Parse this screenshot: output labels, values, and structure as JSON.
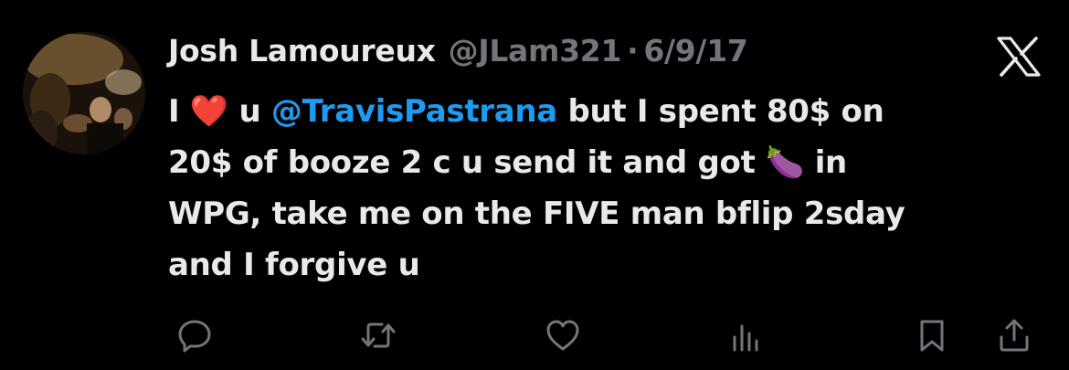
{
  "tweet": {
    "author_name": "Josh Lamoureux",
    "handle": "@JLam321",
    "separator": "·",
    "date": "6/9/17",
    "text_lines": [
      {
        "pre": "I ",
        "emoji": "❤️",
        "mid": " u ",
        "mention": "@TravisPastrana",
        "post": " but I spent 80$ on"
      },
      {
        "pre": "20$ of booze 2 c u send it and got ",
        "emoji": "🍆",
        "post": " in"
      },
      {
        "text": "WPG, take me on the FIVE man bflip 2sday"
      },
      {
        "text": "and I forgive u"
      }
    ]
  },
  "icons": {
    "platform_logo": "x-logo-icon",
    "reply": "reply-icon",
    "retweet": "retweet-icon",
    "like": "heart-icon",
    "views": "views-icon",
    "bookmark": "bookmark-icon",
    "share": "share-icon"
  },
  "colors": {
    "background": "#000000",
    "text": "#e7e9ea",
    "secondary": "#71767b",
    "mention": "#1d9bf0",
    "heart_emoji": "#e0245e"
  }
}
